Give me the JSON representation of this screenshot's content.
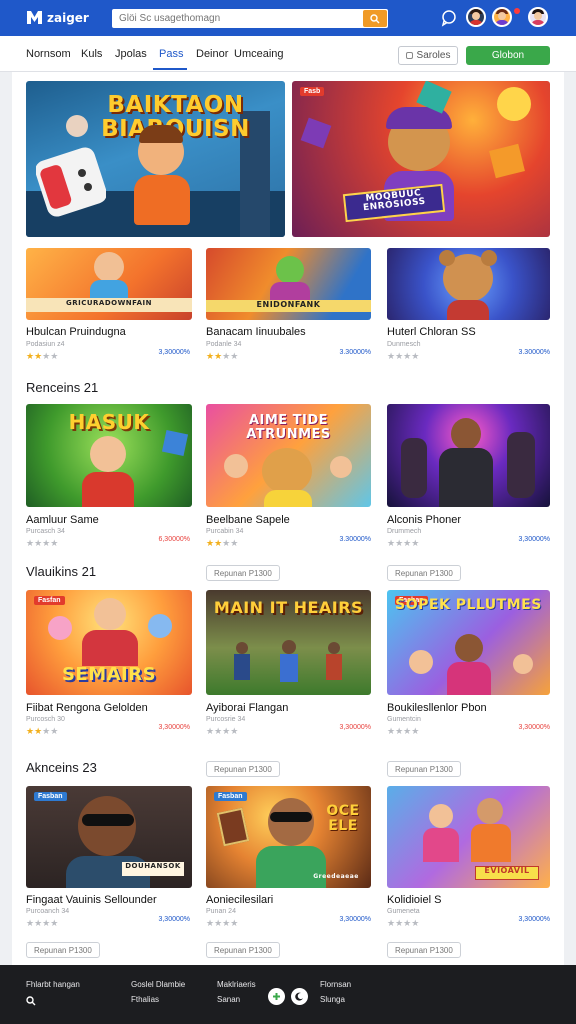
{
  "header": {
    "logo_text": "zaiger",
    "search_placeholder": "Glöi Sc usagethomagn",
    "brand_color": "#1f58c9"
  },
  "nav": {
    "tabs": [
      "Nornsom",
      "Kuls",
      "Jpolas",
      "Pass",
      "Deinor",
      "Umceaing"
    ],
    "active_tab": "Pass",
    "samples_label": "Saroles",
    "cta_label": "Globon"
  },
  "banners": [
    {
      "title": "BAIKTAON BIAROUISN",
      "icon": "game-controller-icon"
    },
    {
      "badge": "Fasb",
      "title": "MOQBUUC ENROSIOSS"
    }
  ],
  "rows": [
    {
      "cards": [
        {
          "art_title": "GRICURADOWNFAIN",
          "title": "Hbulcan Pruindugna",
          "sub": "Podasiun z4",
          "rating": 2,
          "price": "3,30000%",
          "price_color": "#1f58c9"
        },
        {
          "art_title": "ENIDONFANK",
          "title": "Banacam Iinuubales",
          "sub": "Podanle 34",
          "rating": 2,
          "price": "3.30000%",
          "price_color": "#1f58c9"
        },
        {
          "title": "Huterl Chloran SS",
          "sub": "Dunmesch",
          "rating": 0,
          "price": "3.30000%",
          "price_color": "#1f58c9"
        }
      ]
    },
    {
      "section_title": "Renceins 21",
      "cards": [
        {
          "art_title": "HASUK",
          "title": "Aamluur Same",
          "sub": "Purcasch 34",
          "rating": 0,
          "price": "6,30000%",
          "price_color": "#e8433f"
        },
        {
          "art_title": "AIME TIDE ATRUNMES",
          "title": "Beelbane Sapele",
          "sub": "Purcabin 34",
          "rating": 2,
          "price": "3.30000%",
          "price_color": "#1f58c9"
        },
        {
          "title": "Alconis Phoner",
          "sub": "Drummech",
          "rating": 0,
          "price": "3,30000%",
          "price_color": "#1f58c9"
        }
      ]
    },
    {
      "section_title": "Vlauikins 21",
      "pills": [
        "Repunan P1300",
        "Repunan P1300"
      ],
      "cards": [
        {
          "badge": "Fasfan",
          "art_title": "SEMAIRS",
          "title": "Fiibat Rengona Gelolden",
          "sub": "Purcosch 30",
          "rating": 2,
          "price": "3,30000%",
          "price_color": "#e8433f"
        },
        {
          "art_title": "MAIN IT HEAIRS",
          "title": "Ayiborai Flangan",
          "sub": "Purcosrie 34",
          "rating": 0,
          "price": "3,30000%",
          "price_color": "#e8433f"
        },
        {
          "badge": "Fasban",
          "art_title": "SOPEK PLLUTMES",
          "title": "Boukilesllenlor Pbon",
          "sub": "Gumentcin",
          "rating": 0,
          "price": "3,30000%",
          "price_color": "#e8433f"
        }
      ]
    },
    {
      "section_title": "Aknceins 23",
      "pills": [
        "Repunan P1300",
        "Repunan P1300"
      ],
      "cards": [
        {
          "badge": "Fasban",
          "art_title": "DOUHANSOK",
          "title": "Fingaat Vauinis Sellounder",
          "sub": "Purcoanch 34",
          "rating": 0,
          "price": "3,30000%",
          "price_color": "#1f58c9"
        },
        {
          "badge": "Fasban",
          "art_title": "OCE ELE",
          "art_caption": "Greedeaeae",
          "title": "Aoniecilesilari",
          "sub": "Punan 24",
          "rating": 0,
          "price": "3,30000%",
          "price_color": "#1f58c9"
        },
        {
          "art_title": "EVIOAVIL",
          "title": "Kolidioiel S",
          "sub": "Gumeneta",
          "rating": 0,
          "price": "3,30000%",
          "price_color": "#1f58c9"
        }
      ]
    }
  ],
  "bottom_pills": [
    "Repunan P1300",
    "Repunan P1300",
    "Repunan P1300"
  ],
  "footer": {
    "col1": [
      "Fhlarbt hangan"
    ],
    "col2": [
      "Goslel Dlambie",
      "Fthalias"
    ],
    "col3": [
      "Maklriaeris",
      "Sanan"
    ],
    "col4": [
      "Flornsan",
      "Slunga"
    ]
  }
}
